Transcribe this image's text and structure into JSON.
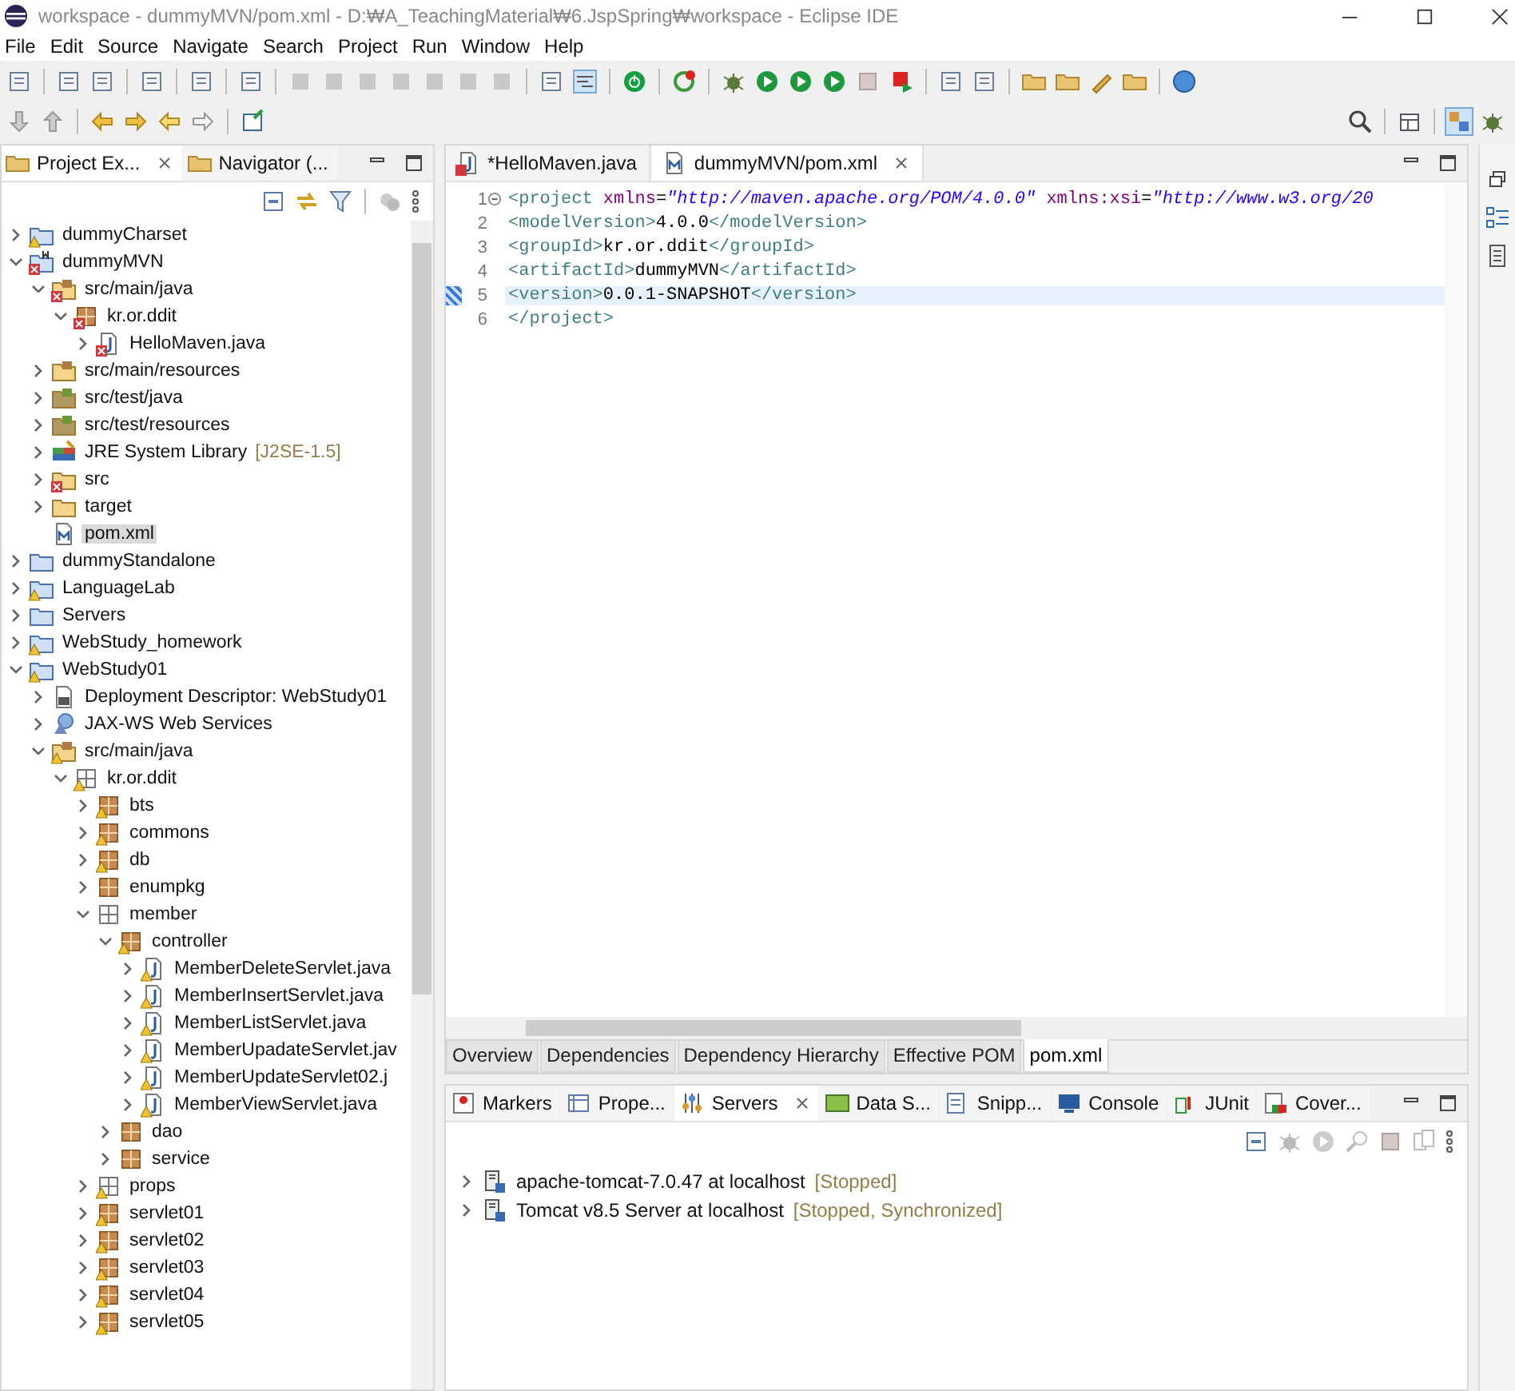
{
  "window": {
    "title": "workspace - dummyMVN/pom.xml - D:₩A_TeachingMaterial₩6.JspSpring₩workspace - Eclipse IDE"
  },
  "menu": [
    "File",
    "Edit",
    "Source",
    "Navigate",
    "Search",
    "Project",
    "Run",
    "Window",
    "Help"
  ],
  "explorer": {
    "tabs": [
      {
        "label": "Project Ex...",
        "selected": true
      },
      {
        "label": "Navigator (...",
        "selected": false
      }
    ],
    "tree": [
      {
        "label": "dummyCharset",
        "kind": "project",
        "error": false,
        "warning": true,
        "expanded": false,
        "selected": false
      },
      {
        "label": "dummyMVN",
        "kind": "maven-project",
        "error": true,
        "warning": false,
        "expanded": true,
        "selected": false,
        "children": [
          {
            "label": "src/main/java",
            "kind": "source-folder",
            "error": true,
            "warning": false,
            "expanded": true,
            "selected": false,
            "children": [
              {
                "label": "kr.or.ddit",
                "kind": "package",
                "error": true,
                "warning": false,
                "expanded": true,
                "selected": false,
                "children": [
                  {
                    "label": "HelloMaven.java",
                    "kind": "java-file",
                    "error": true,
                    "warning": false,
                    "expanded": false,
                    "selected": false
                  }
                ]
              }
            ]
          },
          {
            "label": "src/main/resources",
            "kind": "source-folder",
            "error": false,
            "warning": false,
            "expanded": false,
            "selected": false
          },
          {
            "label": "src/test/java",
            "kind": "test-folder",
            "error": false,
            "warning": false,
            "expanded": false,
            "selected": false
          },
          {
            "label": "src/test/resources",
            "kind": "test-folder",
            "error": false,
            "warning": false,
            "expanded": false,
            "selected": false
          },
          {
            "label": "JRE System Library",
            "note": "[J2SE-1.5]",
            "kind": "library",
            "error": false,
            "warning": false,
            "expanded": false,
            "selected": false
          },
          {
            "label": "src",
            "kind": "folder",
            "error": true,
            "warning": false,
            "expanded": false,
            "selected": false
          },
          {
            "label": "target",
            "kind": "folder",
            "error": false,
            "warning": false,
            "expanded": false,
            "selected": false
          },
          {
            "label": "pom.xml",
            "kind": "xml",
            "error": false,
            "warning": false,
            "selected": true
          }
        ]
      },
      {
        "label": "dummyStandalone",
        "kind": "project",
        "error": false,
        "warning": false,
        "expanded": false,
        "selected": false
      },
      {
        "label": "LanguageLab",
        "kind": "project",
        "error": false,
        "warning": true,
        "expanded": false,
        "selected": false
      },
      {
        "label": "Servers",
        "kind": "plain-project",
        "error": false,
        "warning": false,
        "expanded": false,
        "selected": false
      },
      {
        "label": "WebStudy_homework",
        "kind": "project",
        "error": false,
        "warning": true,
        "expanded": false,
        "selected": false
      },
      {
        "label": "WebStudy01",
        "kind": "project",
        "error": false,
        "warning": true,
        "expanded": true,
        "selected": false,
        "children": [
          {
            "label": "Deployment Descriptor: WebStudy01",
            "kind": "descriptor",
            "error": false,
            "warning": false,
            "expanded": false,
            "selected": false
          },
          {
            "label": "JAX-WS Web Services",
            "kind": "webservices",
            "error": false,
            "warning": false,
            "expanded": false,
            "selected": false
          },
          {
            "label": "src/main/java",
            "kind": "source-folder",
            "error": false,
            "warning": true,
            "expanded": true,
            "selected": false,
            "children": [
              {
                "label": "kr.or.ddit",
                "kind": "package-empty",
                "error": false,
                "warning": true,
                "expanded": true,
                "selected": false,
                "children": [
                  {
                    "label": "bts",
                    "kind": "package",
                    "error": false,
                    "warning": true,
                    "expanded": false,
                    "selected": false
                  },
                  {
                    "label": "commons",
                    "kind": "package",
                    "error": false,
                    "warning": true,
                    "expanded": false,
                    "selected": false
                  },
                  {
                    "label": "db",
                    "kind": "package",
                    "error": false,
                    "warning": true,
                    "expanded": false,
                    "selected": false
                  },
                  {
                    "label": "enumpkg",
                    "kind": "package",
                    "error": false,
                    "warning": false,
                    "expanded": false,
                    "selected": false
                  },
                  {
                    "label": "member",
                    "kind": "package-empty",
                    "error": false,
                    "warning": false,
                    "expanded": true,
                    "selected": false,
                    "children": [
                      {
                        "label": "controller",
                        "kind": "package",
                        "error": false,
                        "warning": true,
                        "expanded": true,
                        "selected": false,
                        "children": [
                          {
                            "label": "MemberDeleteServlet.java",
                            "kind": "java-file",
                            "error": false,
                            "warning": true,
                            "expanded": false,
                            "selected": false
                          },
                          {
                            "label": "MemberInsertServlet.java",
                            "kind": "java-file",
                            "error": false,
                            "warning": true,
                            "expanded": false,
                            "selected": false
                          },
                          {
                            "label": "MemberListServlet.java",
                            "kind": "java-file",
                            "error": false,
                            "warning": true,
                            "expanded": false,
                            "selected": false
                          },
                          {
                            "label": "MemberUpadateServlet.jav",
                            "kind": "java-file",
                            "error": false,
                            "warning": true,
                            "expanded": false,
                            "selected": false
                          },
                          {
                            "label": "MemberUpdateServlet02.j",
                            "kind": "java-file",
                            "error": false,
                            "warning": true,
                            "expanded": false,
                            "selected": false
                          },
                          {
                            "label": "MemberViewServlet.java",
                            "kind": "java-file",
                            "error": false,
                            "warning": true,
                            "expanded": false,
                            "selected": false
                          }
                        ]
                      },
                      {
                        "label": "dao",
                        "kind": "package",
                        "error": false,
                        "warning": false,
                        "expanded": false,
                        "selected": false
                      },
                      {
                        "label": "service",
                        "kind": "package",
                        "error": false,
                        "warning": false,
                        "expanded": false,
                        "selected": false
                      }
                    ]
                  },
                  {
                    "label": "props",
                    "kind": "package-empty",
                    "error": false,
                    "warning": true,
                    "expanded": false,
                    "selected": false
                  },
                  {
                    "label": "servlet01",
                    "kind": "package",
                    "error": false,
                    "warning": true,
                    "expanded": false,
                    "selected": false
                  },
                  {
                    "label": "servlet02",
                    "kind": "package",
                    "error": false,
                    "warning": true,
                    "expanded": false,
                    "selected": false
                  },
                  {
                    "label": "servlet03",
                    "kind": "package",
                    "error": false,
                    "warning": true,
                    "expanded": false,
                    "selected": false
                  },
                  {
                    "label": "servlet04",
                    "kind": "package",
                    "error": false,
                    "warning": true,
                    "expanded": false,
                    "selected": false
                  },
                  {
                    "label": "servlet05",
                    "kind": "package",
                    "error": false,
                    "warning": true,
                    "expanded": false,
                    "selected": false
                  }
                ]
              }
            ]
          }
        ]
      }
    ]
  },
  "editor": {
    "tabs": [
      {
        "label": "*HelloMaven.java",
        "kind": "java-file",
        "selected": false
      },
      {
        "label": "dummyMVN/pom.xml",
        "kind": "xml",
        "selected": true
      }
    ],
    "lines": [
      {
        "number": "1",
        "current": false,
        "tokens": [
          {
            "kind": "tag",
            "text": "<project "
          },
          {
            "kind": "attr",
            "text": "xmlns"
          },
          {
            "kind": "text",
            "text": "="
          },
          {
            "kind": "string",
            "text": "\"http://maven.apache.org/POM/4.0.0\""
          },
          {
            "kind": "attr",
            "text": " xmlns:xsi"
          },
          {
            "kind": "text",
            "text": "="
          },
          {
            "kind": "string",
            "text": "\"http://www.w3.org/20"
          }
        ]
      },
      {
        "number": "2",
        "current": false,
        "tokens": [
          {
            "kind": "tag",
            "text": "  <modelVersion>"
          },
          {
            "kind": "text",
            "text": "4.0.0"
          },
          {
            "kind": "tag",
            "text": "</modelVersion>"
          }
        ]
      },
      {
        "number": "3",
        "current": false,
        "tokens": [
          {
            "kind": "tag",
            "text": "  <groupId>"
          },
          {
            "kind": "text",
            "text": "kr.or.ddit"
          },
          {
            "kind": "tag",
            "text": "</groupId>"
          }
        ]
      },
      {
        "number": "4",
        "current": false,
        "tokens": [
          {
            "kind": "tag",
            "text": "  <artifactId>"
          },
          {
            "kind": "text",
            "text": "dummyMVN"
          },
          {
            "kind": "tag",
            "text": "</artifactId>"
          }
        ]
      },
      {
        "number": "5",
        "current": true,
        "tokens": [
          {
            "kind": "tag",
            "text": "  <version>"
          },
          {
            "kind": "text",
            "text": "0.0.1-SNAPSHOT"
          },
          {
            "kind": "tag",
            "text": "</version>"
          }
        ]
      },
      {
        "number": "6",
        "current": false,
        "tokens": [
          {
            "kind": "tag",
            "text": "</project>"
          }
        ]
      }
    ],
    "page_tabs": [
      {
        "label": "Overview",
        "selected": false
      },
      {
        "label": "Dependencies",
        "selected": false
      },
      {
        "label": "Dependency Hierarchy",
        "selected": false
      },
      {
        "label": "Effective POM",
        "selected": false
      },
      {
        "label": "pom.xml",
        "selected": true
      }
    ]
  },
  "servers_panel": {
    "tabs": [
      {
        "label": "Markers",
        "kind": "markers",
        "selected": false
      },
      {
        "label": "Prope...",
        "kind": "properties",
        "selected": false
      },
      {
        "label": "Servers",
        "kind": "servers",
        "selected": true
      },
      {
        "label": "Data S...",
        "kind": "data",
        "selected": false
      },
      {
        "label": "Snipp...",
        "kind": "snippets",
        "selected": false
      },
      {
        "label": "Console",
        "kind": "console",
        "selected": false
      },
      {
        "label": "JUnit",
        "kind": "junit",
        "selected": false
      },
      {
        "label": "Cover...",
        "kind": "coverage",
        "selected": false
      }
    ],
    "servers": [
      {
        "name": "apache-tomcat-7.0.47 at localhost",
        "status": "[Stopped]"
      },
      {
        "name": "Tomcat v8.5 Server at localhost",
        "status": "[Stopped, Synchronized]"
      }
    ]
  }
}
